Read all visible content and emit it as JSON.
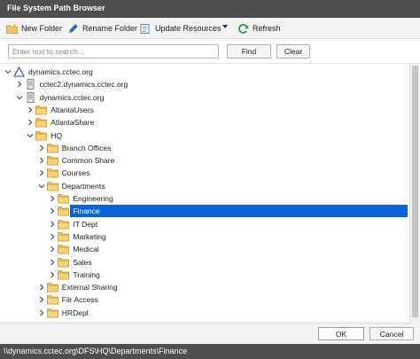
{
  "window": {
    "title": "File System Path Browser"
  },
  "toolbar": {
    "new_folder": "New Folder",
    "rename_folder": "Rename Folder",
    "update_resources": "Update Resources",
    "refresh": "Refresh"
  },
  "search": {
    "placeholder": "Enter text to search...",
    "value": "",
    "find_label": "Find",
    "clear_label": "Clear"
  },
  "colors": {
    "selection": "#0a64d6",
    "folder": "#f2c462",
    "titlebar": "#4f4f4f"
  },
  "tree": [
    {
      "label": "dynamics.cctec.org",
      "depth": 0,
      "icon": "triangle-domain-icon",
      "expander": "open"
    },
    {
      "label": "cctec2.dynamics.cctec.org",
      "depth": 1,
      "icon": "server-icon",
      "expander": "closed"
    },
    {
      "label": "dynamics.cctec.org",
      "depth": 1,
      "icon": "server-icon",
      "expander": "open"
    },
    {
      "label": "AltantaUsers",
      "depth": 2,
      "icon": "folder-icon",
      "expander": "closed"
    },
    {
      "label": "AtlantaShare",
      "depth": 2,
      "icon": "folder-icon",
      "expander": "closed"
    },
    {
      "label": "HQ",
      "depth": 2,
      "icon": "folder-icon",
      "expander": "open"
    },
    {
      "label": "Branch Offices",
      "depth": 3,
      "icon": "folder-icon",
      "expander": "closed"
    },
    {
      "label": "Common Share",
      "depth": 3,
      "icon": "folder-icon",
      "expander": "closed"
    },
    {
      "label": "Courses",
      "depth": 3,
      "icon": "folder-icon",
      "expander": "closed"
    },
    {
      "label": "Departments",
      "depth": 3,
      "icon": "folder-icon",
      "expander": "open"
    },
    {
      "label": "Engineering",
      "depth": 4,
      "icon": "folder-icon",
      "expander": "closed"
    },
    {
      "label": "Finance",
      "depth": 4,
      "icon": "folder-icon",
      "expander": "closed",
      "selected": true
    },
    {
      "label": "IT Dept",
      "depth": 4,
      "icon": "folder-icon",
      "expander": "closed"
    },
    {
      "label": "Marketing",
      "depth": 4,
      "icon": "folder-icon",
      "expander": "closed"
    },
    {
      "label": "Medical",
      "depth": 4,
      "icon": "folder-icon",
      "expander": "closed"
    },
    {
      "label": "Sales",
      "depth": 4,
      "icon": "folder-icon",
      "expander": "closed"
    },
    {
      "label": "Training",
      "depth": 4,
      "icon": "folder-icon",
      "expander": "closed"
    },
    {
      "label": "External Sharing",
      "depth": 3,
      "icon": "folder-icon",
      "expander": "closed"
    },
    {
      "label": "Filr Access",
      "depth": 3,
      "icon": "folder-icon",
      "expander": "closed"
    },
    {
      "label": "HRDept",
      "depth": 3,
      "icon": "folder-icon",
      "expander": "closed"
    }
  ],
  "footer": {
    "ok_label": "OK",
    "cancel_label": "Cancel"
  },
  "status": {
    "path": "\\\\dynamics.cctec.org\\DFS\\HQ\\Departments\\Finance"
  }
}
